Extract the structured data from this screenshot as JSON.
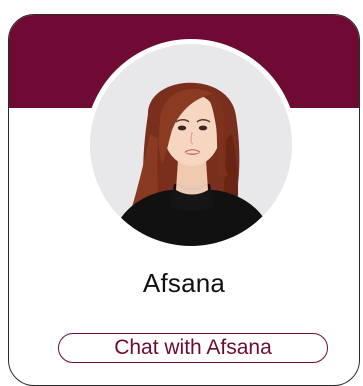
{
  "profile": {
    "name": "Afsana",
    "avatar_alt": "Afsana",
    "chat_label": "Chat with Afsana"
  },
  "colors": {
    "accent": "#6e0a34",
    "card_background": "#ffffff",
    "card_border": "#2b2b2b"
  },
  "icons": {
    "avatar": "profile-photo"
  }
}
